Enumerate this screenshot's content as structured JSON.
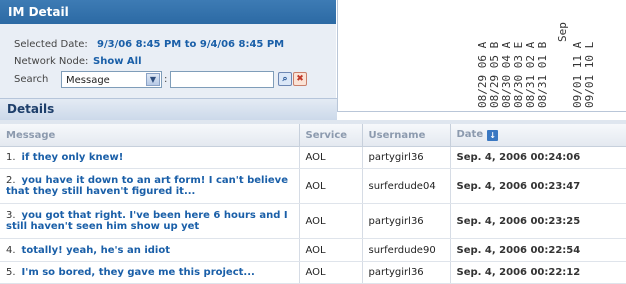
{
  "im_detail": {
    "title": "IM Detail",
    "selected_date_label": "Selected Date:",
    "selected_date_value": "9/3/06 8:45 PM to 9/4/06 8:45 PM",
    "network_node_label": "Network Node:",
    "network_node_value": "Show All",
    "search_label": "Search",
    "search_field_value": "Message",
    "search_text_value": "",
    "colon": ":"
  },
  "chart": {
    "tick_labels": [
      "08/29 06 A",
      "08/29 05 B",
      "08/30 04 A",
      "08/30 03 E",
      "08/31 02 A",
      "08/31 01 B",
      "Sep",
      "09/01 11 A",
      "09/01 10 L"
    ]
  },
  "details": {
    "title": "Details",
    "columns": [
      "Message",
      "Service",
      "Username",
      "Date"
    ],
    "rows": [
      {
        "num": "1.",
        "message": "if they only knew!",
        "service": "AOL",
        "username": "partygirl36",
        "date": "Sep. 4, 2006 00:24:06"
      },
      {
        "num": "2.",
        "message": "you have it down to an art form! I can't believe that they still haven't figured it...",
        "service": "AOL",
        "username": "surferdude04",
        "date": "Sep. 4, 2006 00:23:47"
      },
      {
        "num": "3.",
        "message": "you got that right. I've been here 6 hours and I still haven't seen him show up yet",
        "service": "AOL",
        "username": "partygirl36",
        "date": "Sep. 4, 2006 00:23:25"
      },
      {
        "num": "4.",
        "message": "totally! yeah, he's an idiot",
        "service": "AOL",
        "username": "surferdude90",
        "date": "Sep. 4, 2006 00:22:54"
      },
      {
        "num": "5.",
        "message": "I'm so bored, they gave me this project...",
        "service": "AOL",
        "username": "partygirl36",
        "date": "Sep. 4, 2006 00:22:12"
      }
    ]
  },
  "colors": {
    "header_bg": "#2c6aa4",
    "link": "#1a5fa8",
    "panel_bg": "#e9eef5"
  },
  "icons": {
    "go": "search-go-icon",
    "clear": "clear-icon",
    "sort": "sort-desc-icon",
    "dropdown": "chevron-down-icon"
  }
}
